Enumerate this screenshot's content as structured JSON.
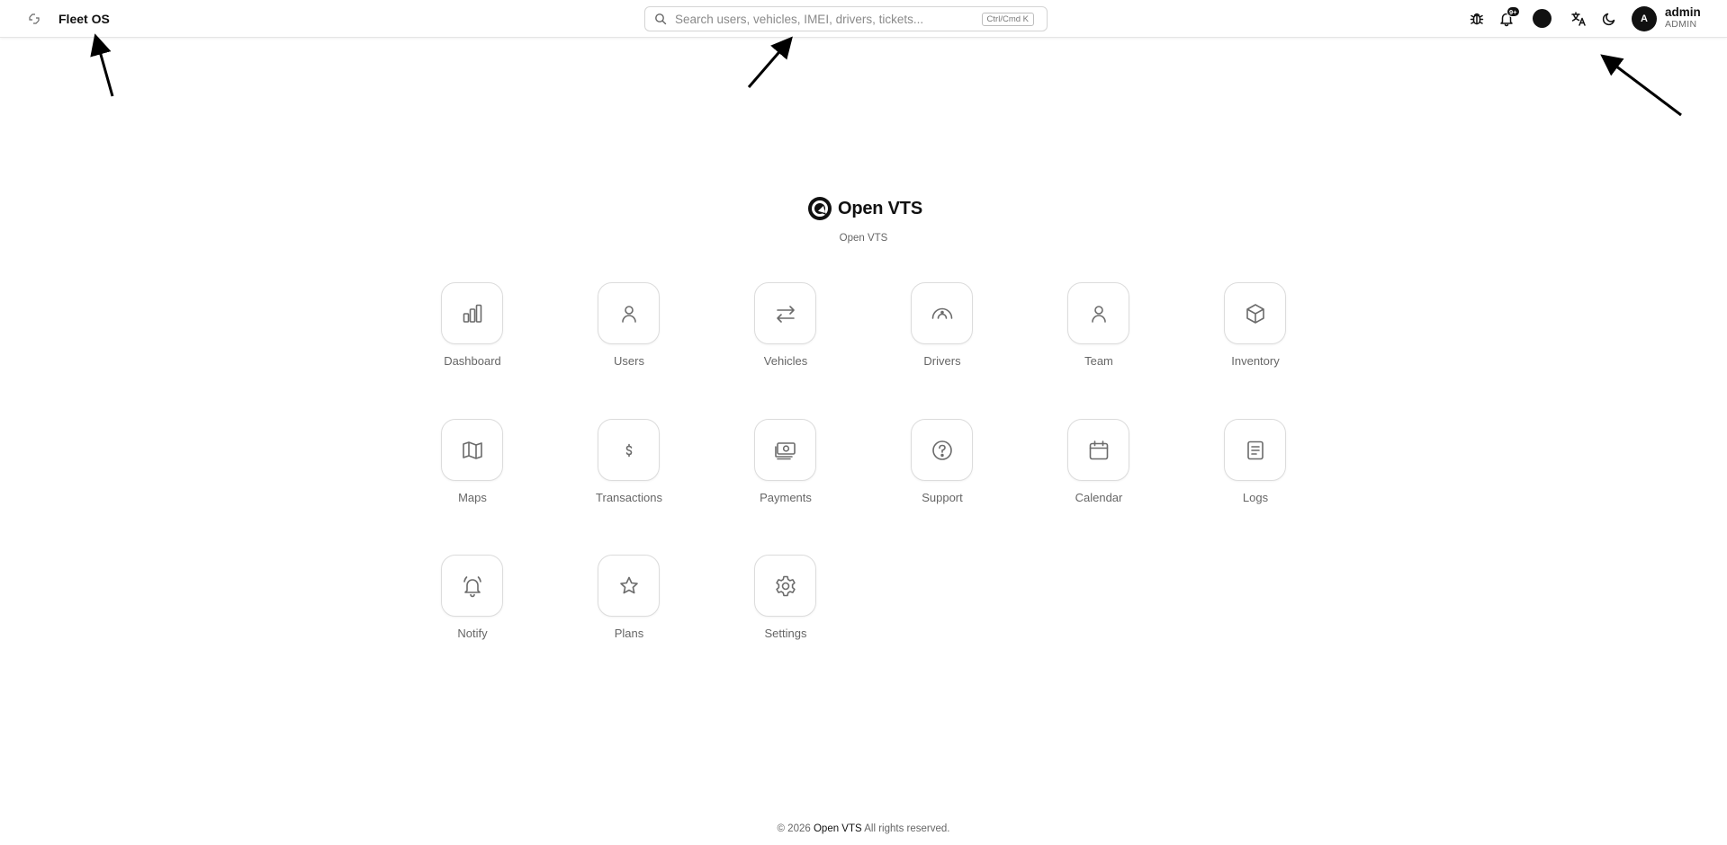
{
  "header": {
    "brand": "Fleet OS",
    "search": {
      "placeholder": "Search users, vehicles, IMEI, drivers, tickets...",
      "shortcut": "Ctrl/Cmd K"
    },
    "notifications_badge": "9+",
    "user": {
      "initial": "A",
      "name": "admin",
      "role": "ADMIN"
    }
  },
  "hero": {
    "title": "Open VTS",
    "subtitle": "Open VTS"
  },
  "apps": [
    {
      "label": "Dashboard",
      "icon": "bar-chart-icon"
    },
    {
      "label": "Users",
      "icon": "user-icon"
    },
    {
      "label": "Vehicles",
      "icon": "arrows-swap-icon"
    },
    {
      "label": "Drivers",
      "icon": "steering-icon"
    },
    {
      "label": "Team",
      "icon": "user-icon"
    },
    {
      "label": "Inventory",
      "icon": "box-icon"
    },
    {
      "label": "Maps",
      "icon": "map-icon"
    },
    {
      "label": "Transactions",
      "icon": "dollar-icon"
    },
    {
      "label": "Payments",
      "icon": "money-icon"
    },
    {
      "label": "Support",
      "icon": "help-circle-icon"
    },
    {
      "label": "Calendar",
      "icon": "calendar-icon"
    },
    {
      "label": "Logs",
      "icon": "document-icon"
    },
    {
      "label": "Notify",
      "icon": "bell-ringing-icon"
    },
    {
      "label": "Plans",
      "icon": "star-icon"
    },
    {
      "label": "Settings",
      "icon": "gear-icon"
    }
  ],
  "footer": {
    "prefix": "© 2026",
    "brand": "Open VTS",
    "suffix": "All rights reserved."
  },
  "colors": {
    "text": "#111111",
    "muted": "#666666",
    "border": "#dcdcdc",
    "icon": "#6b6b6b"
  }
}
